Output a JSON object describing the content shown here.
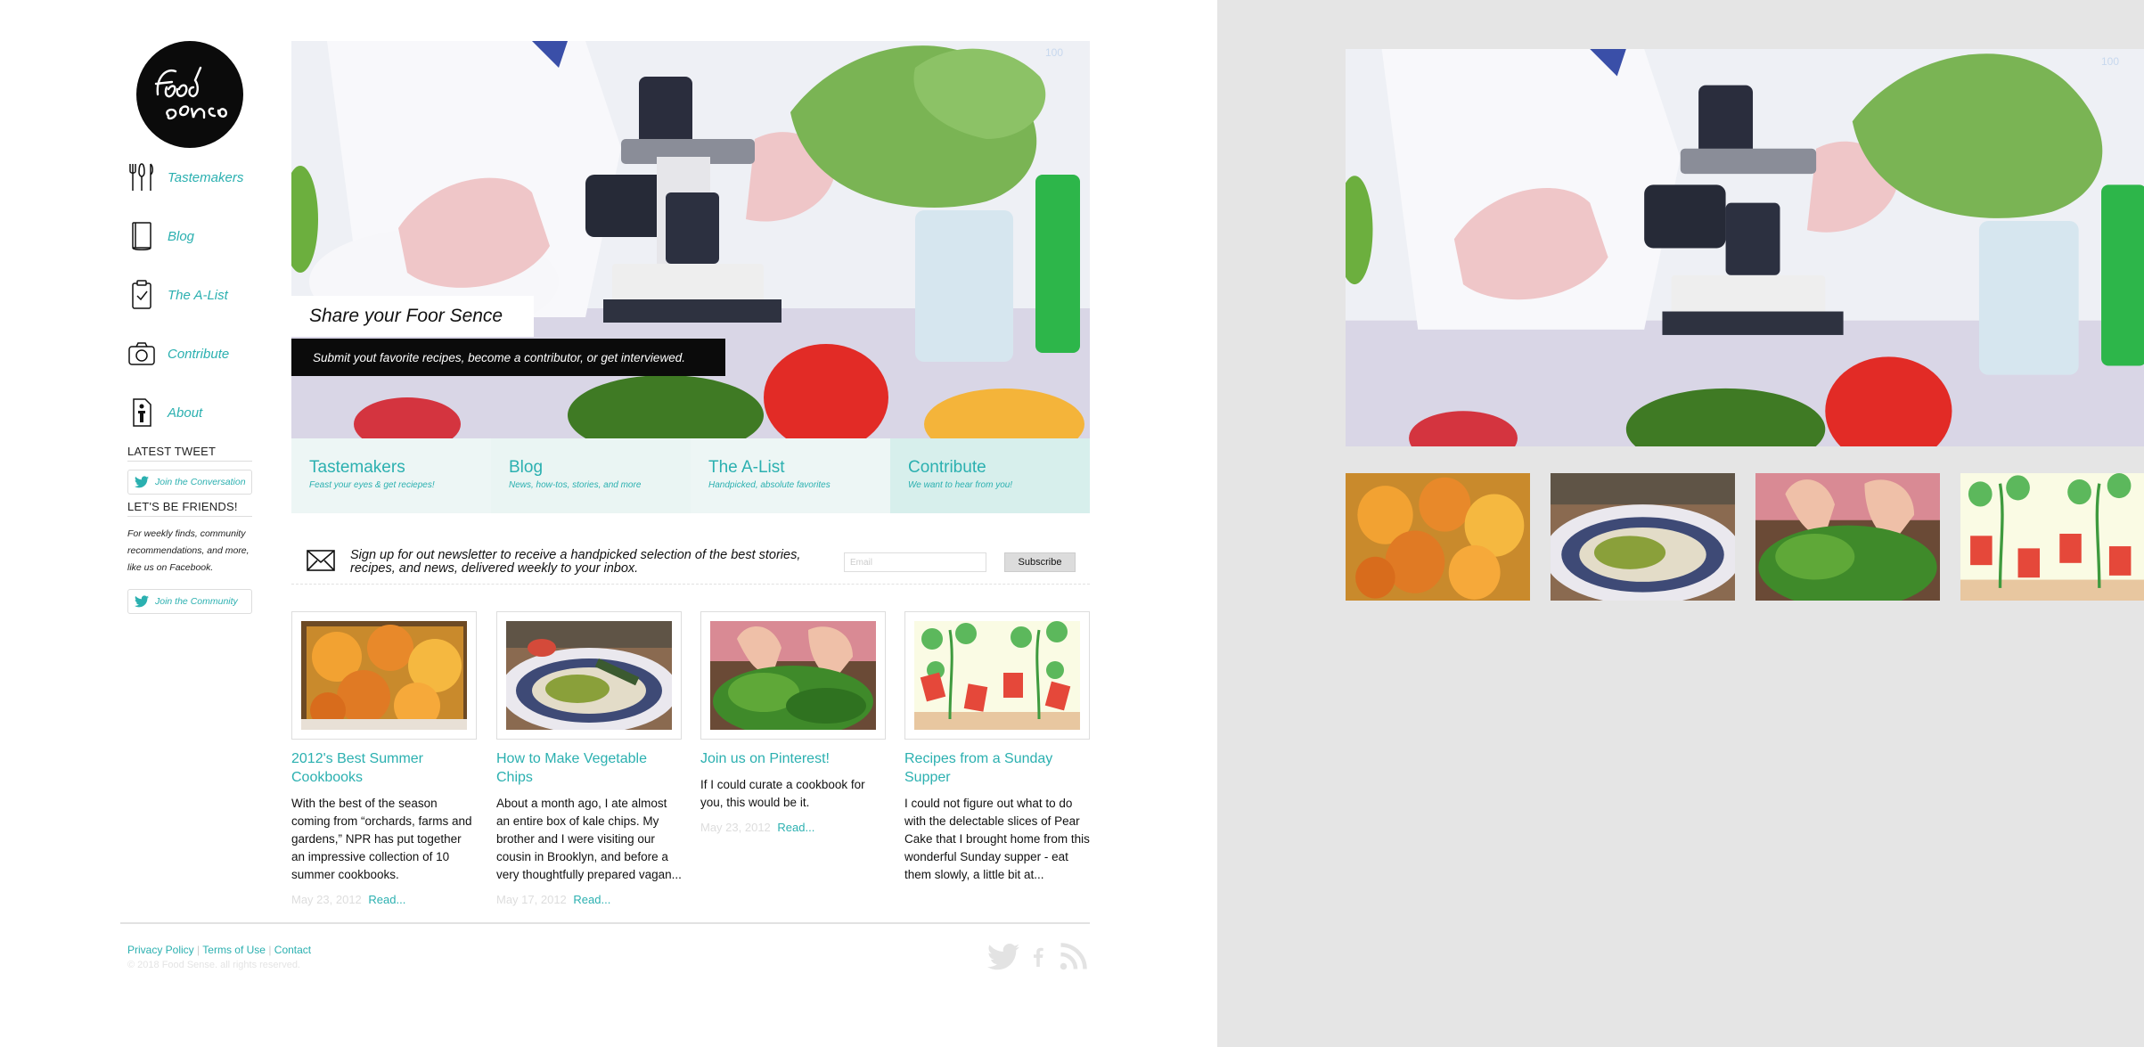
{
  "brand": {
    "logo_text": "Food sense"
  },
  "sidebar": {
    "items": [
      {
        "label": "Tastemakers",
        "icon": "fork-knife-icon"
      },
      {
        "label": "Blog",
        "icon": "book-icon"
      },
      {
        "label": "The A-List",
        "icon": "clipboard-check-icon"
      },
      {
        "label": "Contribute",
        "icon": "camera-icon"
      },
      {
        "label": "About",
        "icon": "person-info-icon"
      }
    ],
    "latest_tweet_heading": "LATEST TWEET",
    "join_conversation": "Join the Conversation",
    "friends_heading": "LET'S BE FRIENDS!",
    "friends_text": "For weekly finds, community recommendations, and more, like us on Facebook.",
    "join_community": "Join the Community"
  },
  "hero": {
    "title": "Share your Foor Sence",
    "subtitle": "Submit yout favorite recipes, become a contributor, or get interviewed.",
    "counter": "100"
  },
  "tabs": [
    {
      "title": "Tastemakers",
      "subtitle": "Feast your eyes & get reciepes!"
    },
    {
      "title": "Blog",
      "subtitle": "News, how-tos, stories, and more"
    },
    {
      "title": "The A-List",
      "subtitle": "Handpicked, absolute favorites"
    },
    {
      "title": "Contribute",
      "subtitle": "We want to hear from you!"
    }
  ],
  "newsletter": {
    "text": "Sign up for out newsletter to receive a handpicked selection of the best stories, recipes, and news, delivered weekly to your inbox.",
    "placeholder": "Email",
    "button": "Subscribe"
  },
  "articles": [
    {
      "title": "2012's Best Summer Cookbooks",
      "body": "With the best of the season coming from “orchards, farms and gardens,” NPR has put together an impressive collection of 10 summer cookbooks.",
      "date": "May 23, 2012",
      "read": "Read..."
    },
    {
      "title": "How to Make Vegetable Chips",
      "body": "About a month ago, I ate almost an entire box of kale chips. My brother and I were visiting our cousin in Brooklyn, and before a very thoughtfully prepared vagan...",
      "date": "May 17, 2012",
      "read": "Read..."
    },
    {
      "title": "Join us on Pinterest!",
      "body": "If I could curate a cookbook for you, this would be it.",
      "date": "May 23, 2012",
      "read": "Read..."
    },
    {
      "title": "Recipes from a Sunday Supper",
      "body": "I could not figure out what to do with the delectable slices of Pear Cake that I brought home from this wonderful Sunday supper - eat them slowly, a little bit at...",
      "date": "",
      "read": ""
    }
  ],
  "footer": {
    "links": [
      "Privacy Policy",
      "Terms of Use",
      "Contact"
    ],
    "separator": "|",
    "copyright": "© 2018 Food Sense. all rights reserved."
  },
  "right_panel": {
    "counter": "100"
  },
  "colors": {
    "accent": "#2bb0b0",
    "tab_bg": "#edf6f5",
    "tab_active": "#d7efec",
    "panel_bg": "#e5e5e5"
  }
}
